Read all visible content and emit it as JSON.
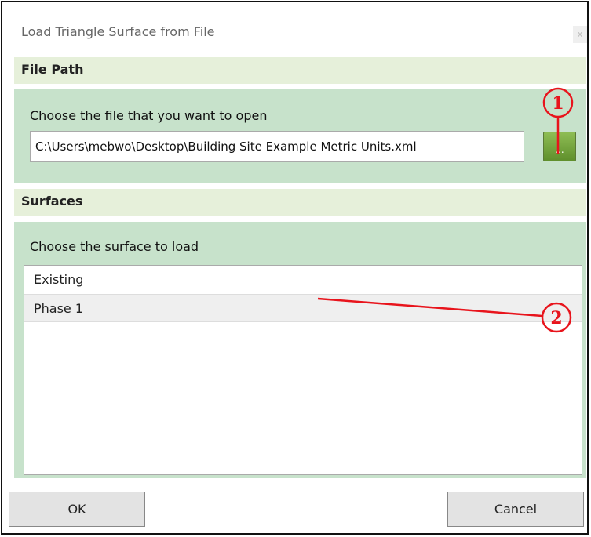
{
  "dialog": {
    "title": "Load Triangle Surface from File",
    "close_label": "x"
  },
  "file_path_section": {
    "header": "File Path",
    "prompt": "Choose the file that you want to open",
    "path_value": "C:\\Users\\mebwo\\Desktop\\Building Site Example Metric Units.xml",
    "browse_label": "..."
  },
  "surfaces_section": {
    "header": "Surfaces",
    "prompt": "Choose the surface to load",
    "items": [
      {
        "label": "Existing",
        "selected": false
      },
      {
        "label": "Phase 1",
        "selected": true
      }
    ]
  },
  "buttons": {
    "ok": "OK",
    "cancel": "Cancel"
  },
  "annotations": {
    "marker_1": "1",
    "marker_2": "2",
    "color": "#e8141c"
  },
  "colors": {
    "section_header": "#e6f0da",
    "section_body": "#c7e2cb",
    "browse_button": "#73a63d"
  }
}
